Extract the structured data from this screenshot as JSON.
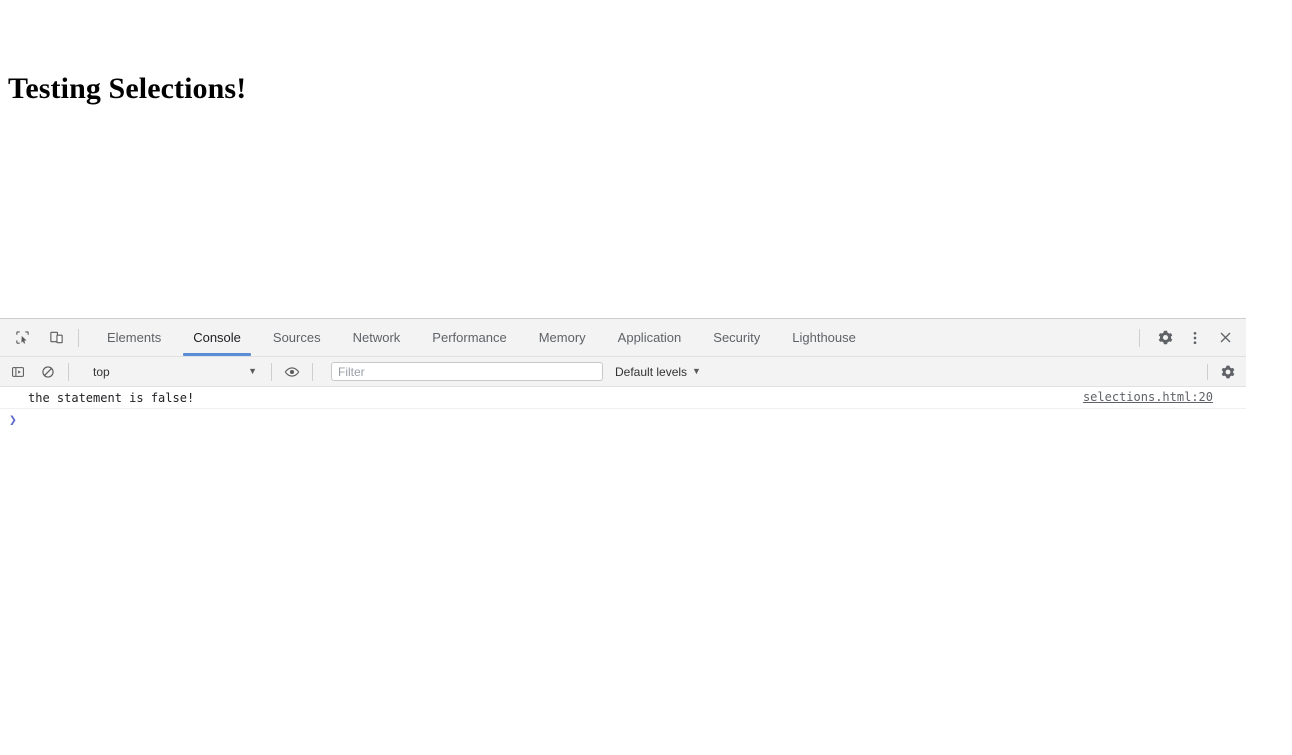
{
  "page": {
    "title": "Testing Selections!"
  },
  "devtools": {
    "toolbar_icons": {
      "inspect": "inspect-element-icon",
      "device": "device-toolbar-icon"
    },
    "tabs": [
      {
        "label": "Elements",
        "active": false
      },
      {
        "label": "Console",
        "active": true
      },
      {
        "label": "Sources",
        "active": false
      },
      {
        "label": "Network",
        "active": false
      },
      {
        "label": "Performance",
        "active": false
      },
      {
        "label": "Memory",
        "active": false
      },
      {
        "label": "Application",
        "active": false
      },
      {
        "label": "Security",
        "active": false
      },
      {
        "label": "Lighthouse",
        "active": false
      }
    ],
    "tabbar_actions": {
      "settings": "gear-icon",
      "more": "kebab-menu-icon",
      "close": "close-icon"
    },
    "filterbar": {
      "sidebar_toggle": "console-sidebar-icon",
      "clear_console": "clear-console-icon",
      "context": "top",
      "context_caret": "▼",
      "live_expression": "eye-icon",
      "filter_value": "",
      "filter_placeholder": "Filter",
      "levels_label": "Default levels",
      "levels_caret": "▼",
      "settings": "gear-icon"
    },
    "console": {
      "messages": [
        {
          "text": "the statement is false!",
          "source": "selections.html:20"
        }
      ],
      "prompt_symbol": "❯",
      "prompt_value": ""
    },
    "colors": {
      "active_tab_underline": "#5b8dd6",
      "prompt_arrow": "#5a67c8",
      "toolbar_bg": "#f3f3f3"
    }
  }
}
